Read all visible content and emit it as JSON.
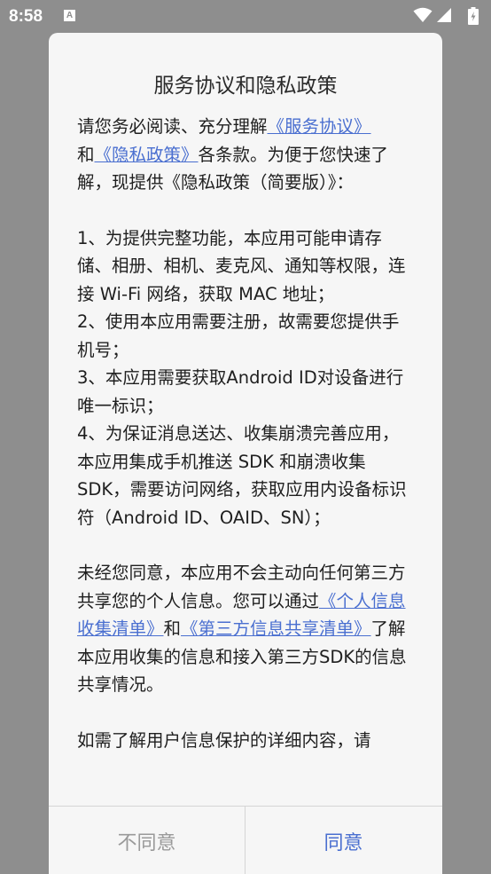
{
  "status_bar": {
    "time": "8:58",
    "notification_letter": "A"
  },
  "dialog": {
    "title": "服务协议和隐私政策",
    "intro": {
      "t1": "请您务必阅读、充分理解",
      "link_service": "《服务协议》",
      "t2": "和",
      "link_privacy": "《隐私政策》",
      "t3": "各条款。为便于您快速了解，现提供《隐私政策（简要版）》："
    },
    "items": [
      "1、为提供完整功能，本应用可能申请存储、相册、相机、麦克风、通知等权限，连接 Wi-Fi 网络，获取 MAC 地址；",
      "2、使用本应用需要注册，故需要您提供手机号；",
      "3、本应用需要获取Android ID对设备进行唯一标识；",
      "4、为保证消息送达、收集崩溃完善应用，本应用集成手机推送 SDK 和崩溃收集 SDK，需要访问网络，获取应用内设备标识符（Android ID、OAID、SN）；"
    ],
    "sharing": {
      "t1": "未经您同意，本应用不会主动向任何第三方共享您的个人信息。您可以通过",
      "link_list": "《个人信息收集清单》",
      "t2": "和",
      "link_third": "《第三方信息共享清单》",
      "t3": "了解本应用收集的信息和接入第三方SDK的信息共享情况。"
    },
    "more": "如需了解用户信息保护的详细内容，请",
    "buttons": {
      "disagree": "不同意",
      "agree": "同意"
    }
  },
  "colors": {
    "link": "#4a6fd0",
    "scrim": "#8e8e8e",
    "dialog_bg": "#f6f6f6"
  }
}
